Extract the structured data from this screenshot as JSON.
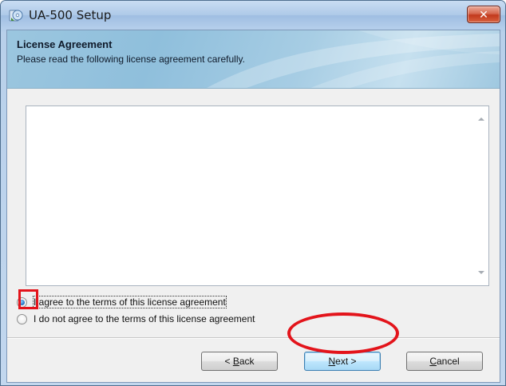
{
  "window": {
    "title": "UA-500 Setup",
    "close_glyph": "✕"
  },
  "banner": {
    "title": "License Agreement",
    "subtitle": "Please read the following license agreement carefully."
  },
  "license": {
    "text": ""
  },
  "options": {
    "agree_label": "I agree to the terms of this license agreement",
    "agree_selected": true,
    "disagree_label": "I do not agree to the terms of this license agreement",
    "disagree_selected": false
  },
  "buttons": {
    "back_prefix": "< ",
    "back_mnemonic": "B",
    "back_rest": "ack",
    "next_mnemonic": "N",
    "next_rest": "ext >",
    "cancel_mnemonic": "C",
    "cancel_rest": "ancel"
  },
  "annotations": {
    "highlight_color": "#e3141b"
  },
  "icons": {
    "title_icon": "setup-disc-icon",
    "scroll_up": "scroll-up-arrow-icon",
    "scroll_down": "scroll-down-arrow-icon"
  }
}
